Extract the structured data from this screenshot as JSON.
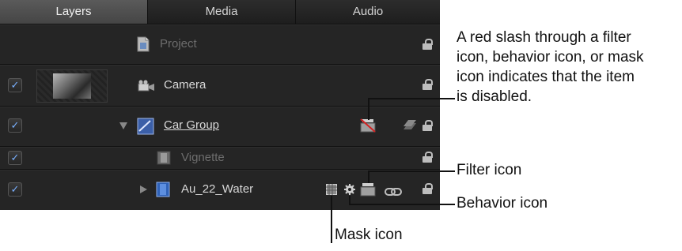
{
  "tabs": [
    {
      "label": "Layers",
      "active": true
    },
    {
      "label": "Media",
      "active": false
    },
    {
      "label": "Audio",
      "active": false
    }
  ],
  "layers": [
    {
      "name": "Project",
      "checked": false,
      "state": "dimmed",
      "icon": "project-icon"
    },
    {
      "name": "Camera",
      "checked": true,
      "state": "normal",
      "icon": "camera-icon",
      "has_thumbnail": true
    },
    {
      "name": "Car Group",
      "checked": true,
      "state": "underlined",
      "icon": "group-icon",
      "disclosure": "expanded",
      "badges": [
        "filter-icon-disabled",
        "stack-icon"
      ]
    },
    {
      "name": "Vignette",
      "checked": true,
      "state": "dimmed",
      "icon": "film-icon"
    },
    {
      "name": "Au_22_Water",
      "checked": true,
      "state": "normal",
      "icon": "film-icon",
      "disclosure": "collapsed",
      "badges": [
        "mask-icon",
        "behavior-icon",
        "filter-icon",
        "link-icon"
      ]
    }
  ],
  "callouts": {
    "disabled": "A red slash through a filter icon, behavior icon, or mask icon indicates that the item is disabled.",
    "disabled_lines": [
      "A red slash through a filter",
      "icon, behavior icon, or mask",
      "icon indicates that the item",
      "is disabled."
    ],
    "filter": "Filter icon",
    "behavior": "Behavior icon",
    "mask": "Mask icon"
  },
  "colors": {
    "panel_bg": "#202020",
    "accent_check": "#7ab0ff",
    "disabled_slash": "#d22222"
  }
}
